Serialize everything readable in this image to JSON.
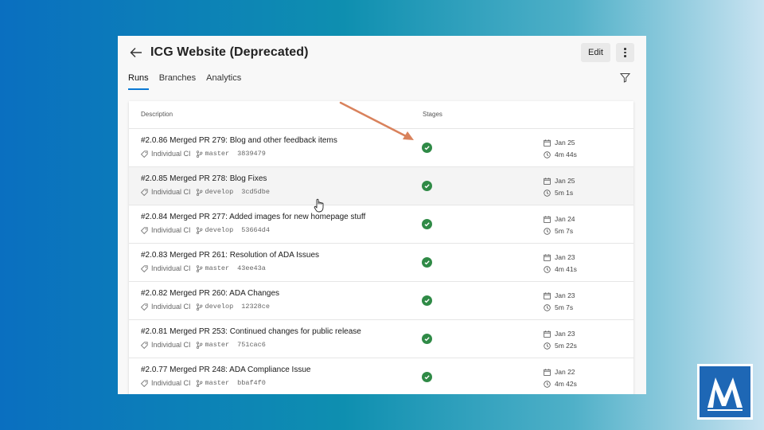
{
  "header": {
    "title": "ICG Website (Deprecated)",
    "edit_label": "Edit"
  },
  "tabs": [
    {
      "label": "Runs",
      "active": true
    },
    {
      "label": "Branches",
      "active": false
    },
    {
      "label": "Analytics",
      "active": false
    }
  ],
  "table": {
    "columns": {
      "description": "Description",
      "stages": "Stages"
    },
    "rows": [
      {
        "title": "#2.0.86 Merged PR 279: Blog and other feedback items",
        "trigger": "Individual CI",
        "branch": "master",
        "commit": "3839479",
        "date": "Jan 25",
        "duration": "4m 44s",
        "status": "succeeded"
      },
      {
        "title": "#2.0.85 Merged PR 278: Blog Fixes",
        "trigger": "Individual CI",
        "branch": "develop",
        "commit": "3cd5dbe",
        "date": "Jan 25",
        "duration": "5m 1s",
        "status": "succeeded"
      },
      {
        "title": "#2.0.84 Merged PR 277: Added images for new homepage stuff",
        "trigger": "Individual CI",
        "branch": "develop",
        "commit": "53664d4",
        "date": "Jan 24",
        "duration": "5m 7s",
        "status": "succeeded"
      },
      {
        "title": "#2.0.83 Merged PR 261: Resolution of ADA Issues",
        "trigger": "Individual CI",
        "branch": "master",
        "commit": "43ee43a",
        "date": "Jan 23",
        "duration": "4m 41s",
        "status": "succeeded"
      },
      {
        "title": "#2.0.82 Merged PR 260: ADA Changes",
        "trigger": "Individual CI",
        "branch": "develop",
        "commit": "12328ce",
        "date": "Jan 23",
        "duration": "5m 7s",
        "status": "succeeded"
      },
      {
        "title": "#2.0.81 Merged PR 253: Continued changes for public release",
        "trigger": "Individual CI",
        "branch": "master",
        "commit": "751cac6",
        "date": "Jan 23",
        "duration": "5m 22s",
        "status": "succeeded"
      },
      {
        "title": "#2.0.77 Merged PR 248: ADA Compliance Issue",
        "trigger": "Individual CI",
        "branch": "master",
        "commit": "bbaf4f0",
        "date": "Jan 22",
        "duration": "4m 42s",
        "status": "succeeded"
      }
    ]
  },
  "colors": {
    "accent": "#0a78d4",
    "success": "#2f8a46",
    "annotation_arrow": "#d9825c",
    "logo_blue": "#1e67b5"
  },
  "icons": {
    "back": "arrow-left-icon",
    "more": "more-vertical-icon",
    "filter": "funnel-icon",
    "trigger": "tag-icon",
    "branch": "branch-icon",
    "stage": "check-circle-icon",
    "date": "calendar-icon",
    "duration": "clock-icon"
  }
}
